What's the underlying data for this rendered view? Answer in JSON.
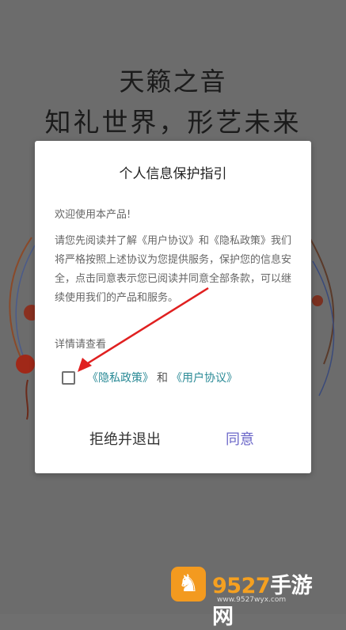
{
  "background": {
    "title_line1": "天籁之音",
    "title_line2": "知礼世界，形艺未来"
  },
  "dialog": {
    "title": "个人信息保护指引",
    "welcome": "欢迎使用本产品!",
    "body": "请您先阅读并了解《用户协议》和《隐私政策》我们将严格按照上述协议为您提供服务，保护您的信息安全，点击同意表示您已阅读并同意全部条款，可以继续使用我们的产品和服务。",
    "details_label": "详情请查看",
    "checkbox_checked": false,
    "privacy_link": "《隐私政策》",
    "and_text": "和",
    "user_agreement_link": "《用户协议》",
    "reject_button": "拒绝并退出",
    "agree_button": "同意"
  },
  "colors": {
    "link": "#2a8a96",
    "agree_button": "#6b67c8",
    "annotation_arrow": "#e02020"
  },
  "watermark": {
    "logo_icon": "horse-icon",
    "name_digits": "9527",
    "name_cn": "手游网",
    "url": "www.9527wyx.com"
  }
}
